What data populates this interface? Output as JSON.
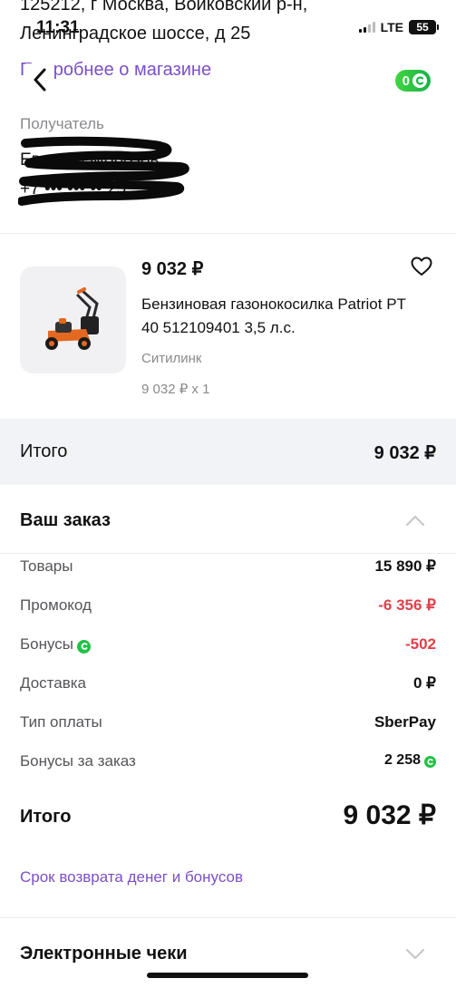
{
  "header": {
    "address_line1": "125212, г Москва, Войковский р-н,",
    "address_line2": "Ленинградское шоссе, д 25",
    "store_link": "Подробнее о магазине",
    "bonus_count": "0"
  },
  "status_bar": {
    "time": "11:31",
    "network": "LTE",
    "battery": "55"
  },
  "recipient": {
    "label": "Получатель",
    "name": "Евгений Морозов",
    "phone": "+7 ••• ••• •• 25"
  },
  "product": {
    "price": "9 032 ₽",
    "name": "Бензиновая газонокосилка Patriot PT 40 512109401 3,5 л.с.",
    "seller": "Ситилинк",
    "quantity": "9 032 ₽ x 1"
  },
  "total_band": {
    "label": "Итого",
    "value": "9 032 ₽"
  },
  "order": {
    "title": "Ваш заказ",
    "rows": [
      {
        "label": "Товары",
        "value": "15 890 ₽"
      },
      {
        "label": "Промокод",
        "value": "-6 356 ₽"
      },
      {
        "label": "Бонусы",
        "value": "-502"
      },
      {
        "label": "Доставка",
        "value": "0 ₽"
      },
      {
        "label": "Тип оплаты",
        "value": "SberPay"
      },
      {
        "label": "Бонусы за заказ",
        "value": "2 258"
      }
    ],
    "grand_total_label": "Итого",
    "grand_total_value": "9 032 ₽",
    "refund_link": "Срок возврата денег и бонусов"
  },
  "receipts": {
    "title": "Электронные чеки"
  },
  "colors": {
    "accent": "#7b4fc7",
    "negative": "#e0404a",
    "bonus_green": "#21c145",
    "band_bg": "#f2f3f6"
  }
}
